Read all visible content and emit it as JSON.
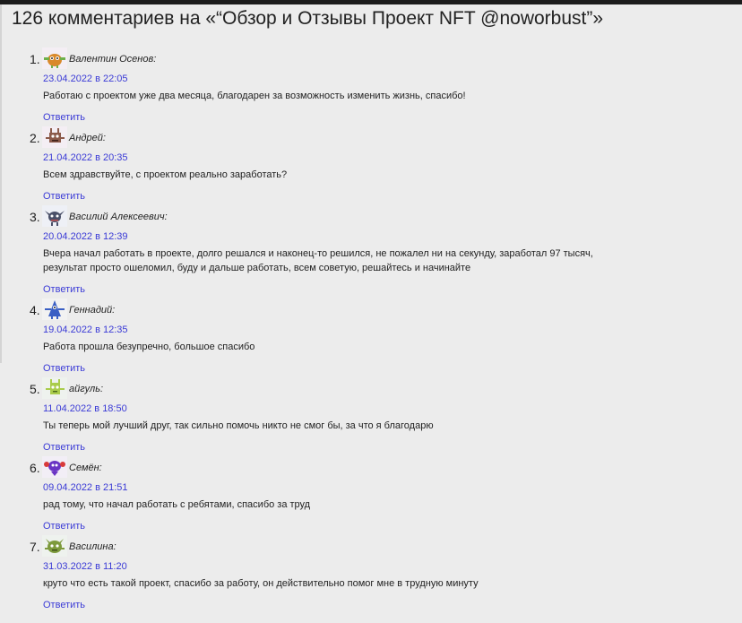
{
  "title": "126 комментариев на «“Обзор и Отзывы Проект NFT @noworbust”»",
  "reply_label": "Ответить",
  "colors": {
    "link": "#3a3ad6",
    "background": "#ececec",
    "text": "#222222"
  },
  "comments": [
    {
      "number": "1.",
      "author": "Валентин Осенов",
      "avatar_icon": "orange-monster-avatar-icon",
      "date": "23.04.2022 в 22:05",
      "text": "Работаю с проектом уже два месяца, благодарен за возможность изменить жизнь, спасибо!"
    },
    {
      "number": "2.",
      "author": "Андрей",
      "avatar_icon": "brown-monster-avatar-icon",
      "date": "21.04.2022 в 20:35",
      "text": "Всем здравствуйте, с проектом реально заработать?"
    },
    {
      "number": "3.",
      "author": "Василий Алексеевич",
      "avatar_icon": "horned-monster-avatar-icon",
      "date": "20.04.2022 в 12:39",
      "text": "Вчера начал работать в проекте, долго решался и наконец-то решился, не пожалел ни на секунду, заработал 97 тысяч, результат просто ошеломил, буду и дальше работать, всем советую, решайтесь и начинайте"
    },
    {
      "number": "4.",
      "author": "Геннадий",
      "avatar_icon": "blue-monster-avatar-icon",
      "date": "19.04.2022 в 12:35",
      "text": "Работа прошла безупречно, большое спасибо"
    },
    {
      "number": "5.",
      "author": "айгуль",
      "avatar_icon": "green-monster-avatar-icon",
      "date": "11.04.2022 в 18:50",
      "text": "Ты теперь мой лучший друг, так сильно помочь никто не смог бы, за что я благодарю"
    },
    {
      "number": "6.",
      "author": "Семён",
      "avatar_icon": "purple-monster-avatar-icon",
      "date": "09.04.2022 в 21:51",
      "text": "рад тому, что начал работать с ребятами, спасибо за труд"
    },
    {
      "number": "7.",
      "author": "Василина",
      "avatar_icon": "olive-monster-avatar-icon",
      "date": "31.03.2022 в 11:20",
      "text": "круто что есть такой проект, спасибо за работу, он действительно помог мне в трудную минуту"
    }
  ]
}
